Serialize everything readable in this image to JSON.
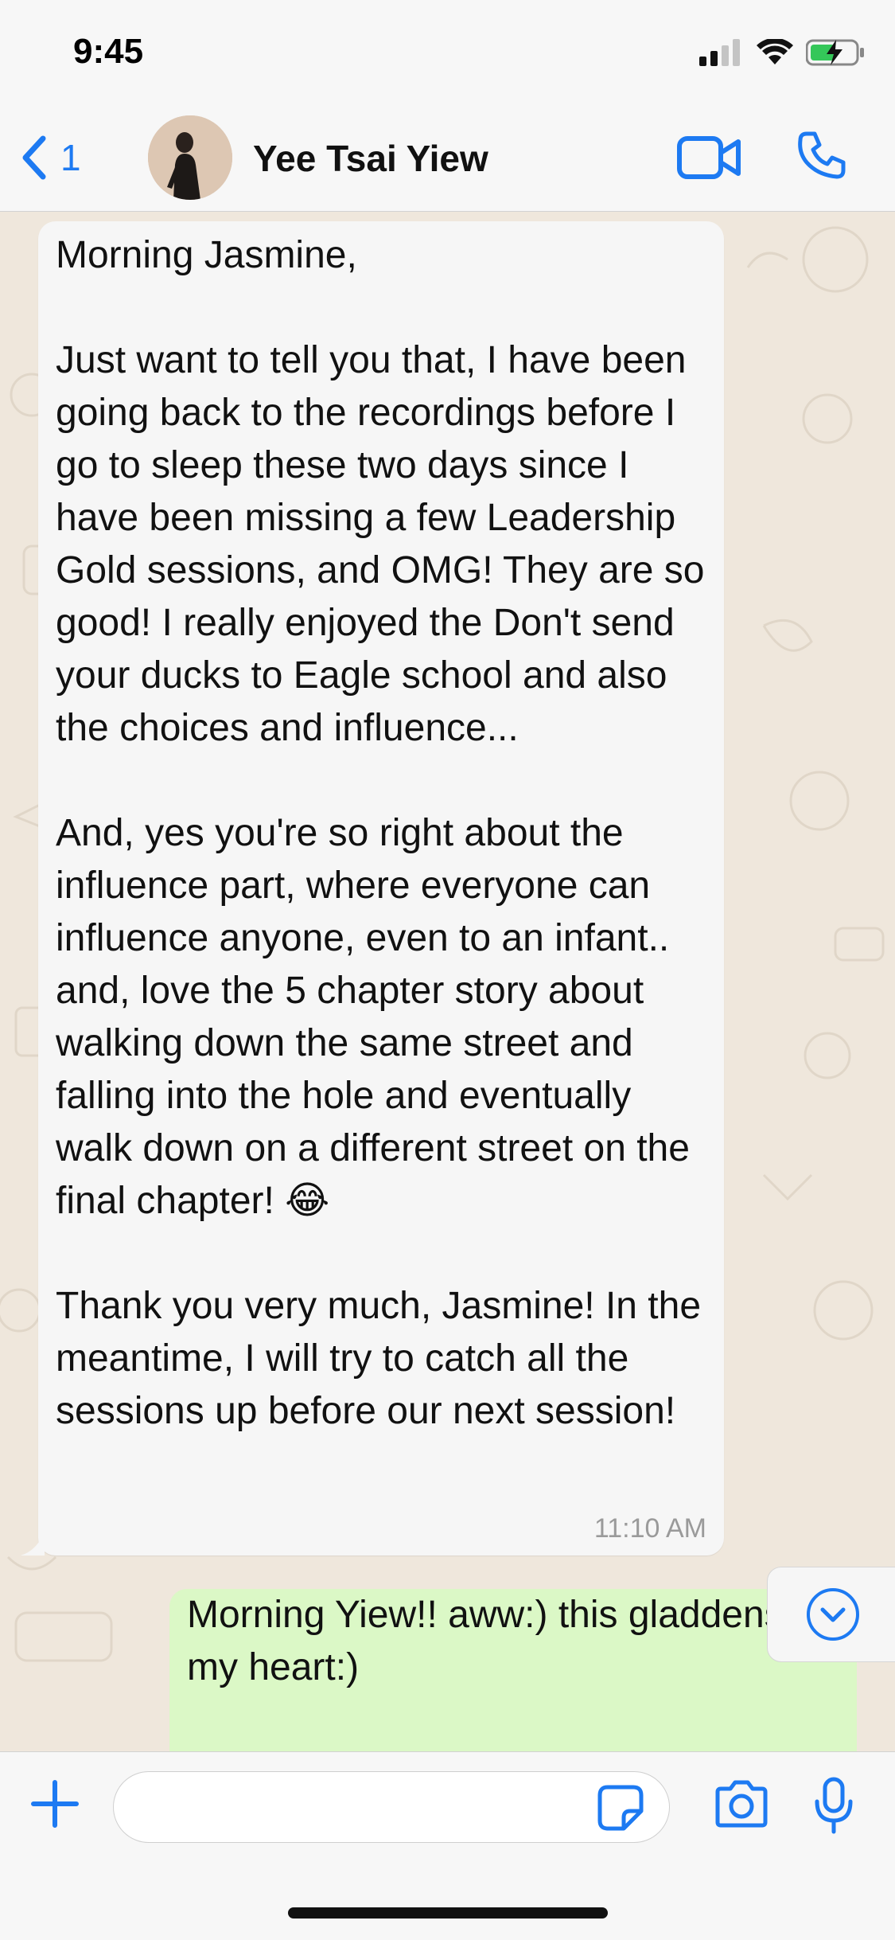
{
  "status_bar": {
    "time": "9:45"
  },
  "header": {
    "back_count": "1",
    "contact_name": "Yee Tsai Yiew"
  },
  "messages": [
    {
      "direction": "incoming",
      "text": "Morning Jasmine,\n\nJust want to tell you that, I have been going back to the recordings before I go to sleep these two days since I have been missing a few Leadership Gold sessions, and OMG! They are so good! I really enjoyed the Don't send your ducks to Eagle school and also the choices and influence...\n\nAnd, yes you're so right about the influence part, where everyone can influence anyone, even to an infant.. and, love the 5 chapter story about walking down the same street and falling into the hole and eventually walk down on a different street on the final chapter! 😂\n\nThank you very much, Jasmine! In the meantime, I will try to catch all the sessions up before our next session!",
      "time": "11:10 AM"
    },
    {
      "direction": "outgoing",
      "text": "Morning Yiew!! aww:) this gladdens my heart:)"
    }
  ],
  "colors": {
    "accent": "#1d7af2",
    "incoming_bubble": "#f6f6f6",
    "outgoing_bubble": "#dbf8c6",
    "wallpaper": "#efe7dc"
  },
  "icons": {
    "back": "chevron-left-icon",
    "video": "video-camera-icon",
    "call": "phone-icon",
    "scroll": "chevron-down-circle-icon",
    "plus": "plus-icon",
    "sticker": "sticker-icon",
    "camera": "camera-icon",
    "mic": "microphone-icon"
  }
}
